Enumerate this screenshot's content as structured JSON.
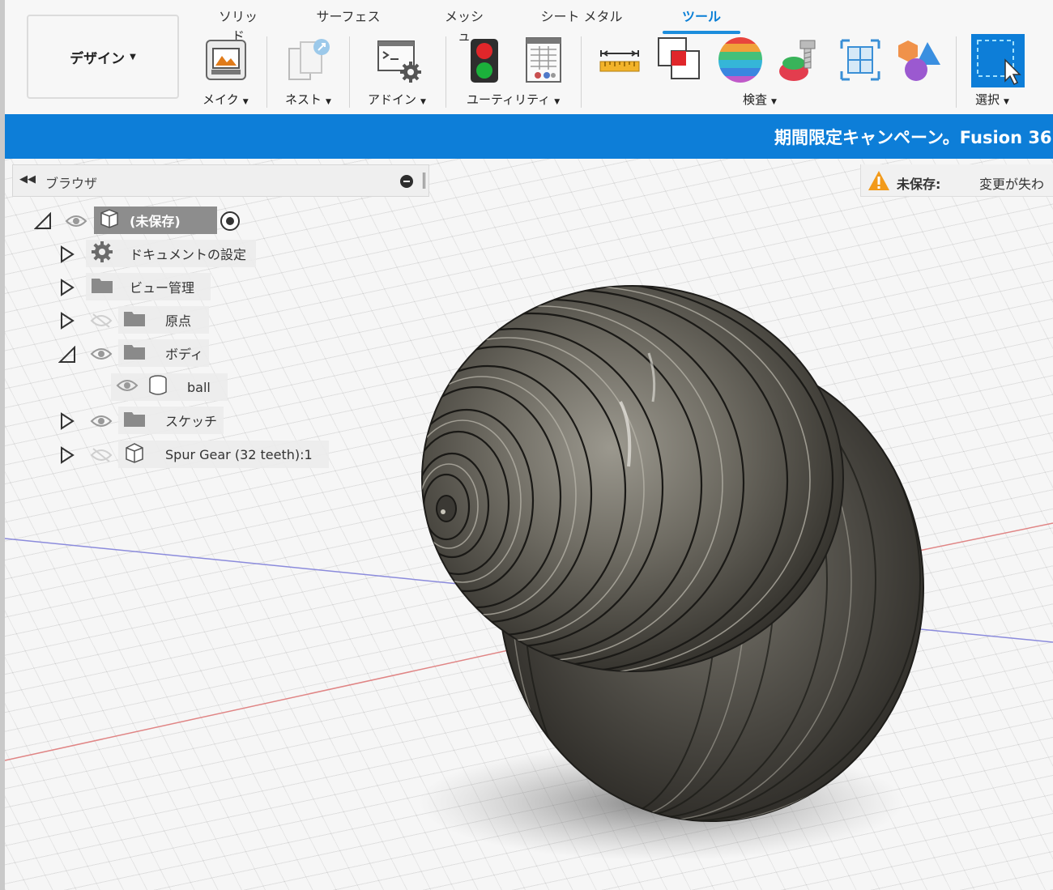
{
  "workspace": {
    "label": "デザイン"
  },
  "tabs": [
    {
      "label": "ソリッド",
      "active": false
    },
    {
      "label": "サーフェス",
      "active": false
    },
    {
      "label": "メッシュ",
      "active": false
    },
    {
      "label": "シート メタル",
      "active": false
    },
    {
      "label": "ツール",
      "active": true
    }
  ],
  "groups": {
    "make": "メイク",
    "nest": "ネスト",
    "addin": "アドイン",
    "utility": "ユーティリティ",
    "inspect": "検査",
    "select": "選択"
  },
  "banner": {
    "text": "期間限定キャンペーン。Fusion 36"
  },
  "browser": {
    "title": "ブラウザ",
    "root": {
      "label": "(未保存)"
    },
    "items": [
      {
        "label": "ドキュメントの設定",
        "icon": "gear-icon"
      },
      {
        "label": "ビュー管理",
        "icon": "folder-icon"
      },
      {
        "label": "原点",
        "icon": "folder-icon",
        "visible": false
      },
      {
        "label": "ボディ",
        "icon": "folder-icon",
        "expanded": true
      },
      {
        "label": "ball",
        "icon": "body-icon"
      },
      {
        "label": "スケッチ",
        "icon": "folder-icon"
      },
      {
        "label": "Spur Gear (32 teeth):1",
        "icon": "component-icon",
        "visible": false
      }
    ]
  },
  "warning": {
    "label": "未保存:",
    "text": "変更が失わ"
  },
  "colors": {
    "accent": "#0D7ED8",
    "active_tab": "#0A7FD6",
    "body": "#5A5850"
  }
}
